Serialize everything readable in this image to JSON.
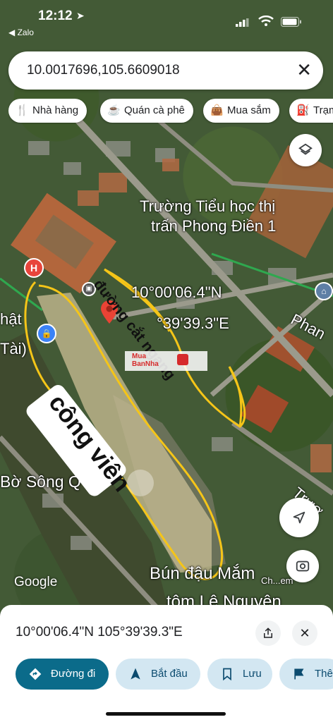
{
  "status_bar": {
    "time": "12:12",
    "back_app": "◀ Zalo"
  },
  "search": {
    "query": "10.0017696,105.6609018"
  },
  "chips": [
    {
      "icon": "restaurant-icon",
      "label": "Nhà hàng"
    },
    {
      "icon": "coffee-icon",
      "label": "Quán cà phê"
    },
    {
      "icon": "shopping-bag-icon",
      "label": "Mua sắm"
    },
    {
      "icon": "gas-station-icon",
      "label": "Trạm"
    }
  ],
  "map": {
    "labels": {
      "school_line1": "Trường Tiểu học thị",
      "school_line2": "trấn Phong Điền 1",
      "coord_line1": "10°00'06.4\"N",
      "coord_line2": "°39'39.3\"E",
      "phat": "hật",
      "tai": "Tài)",
      "phan": "Phan",
      "bo_song": "Bờ Sông Q",
      "truong": "Trươ",
      "bun_line1": "Bún đậu Mắm",
      "bun_line2": "tôm Lê Nguyên",
      "ch": "Ch...em",
      "google": "Google"
    },
    "annotations": {
      "duong_cat_ngang": "đường cắt ngang",
      "cong_vien": "công viên"
    },
    "watermark": "Mua\nBanNha"
  },
  "sheet": {
    "coords": "10°00'06.4\"N 105°39'39.3\"E",
    "actions": [
      {
        "label": "Đường đi",
        "icon": "directions-icon"
      },
      {
        "label": "Bắt đầu",
        "icon": "navigation-icon"
      },
      {
        "label": "Lưu",
        "icon": "bookmark-icon"
      },
      {
        "label": "Thê",
        "icon": "flag-icon"
      }
    ]
  },
  "colors": {
    "accent": "#0b6b8a",
    "chip_bg": "#ffffff",
    "annotation_line": "#f5c518",
    "road_green": "#2fa84f"
  }
}
